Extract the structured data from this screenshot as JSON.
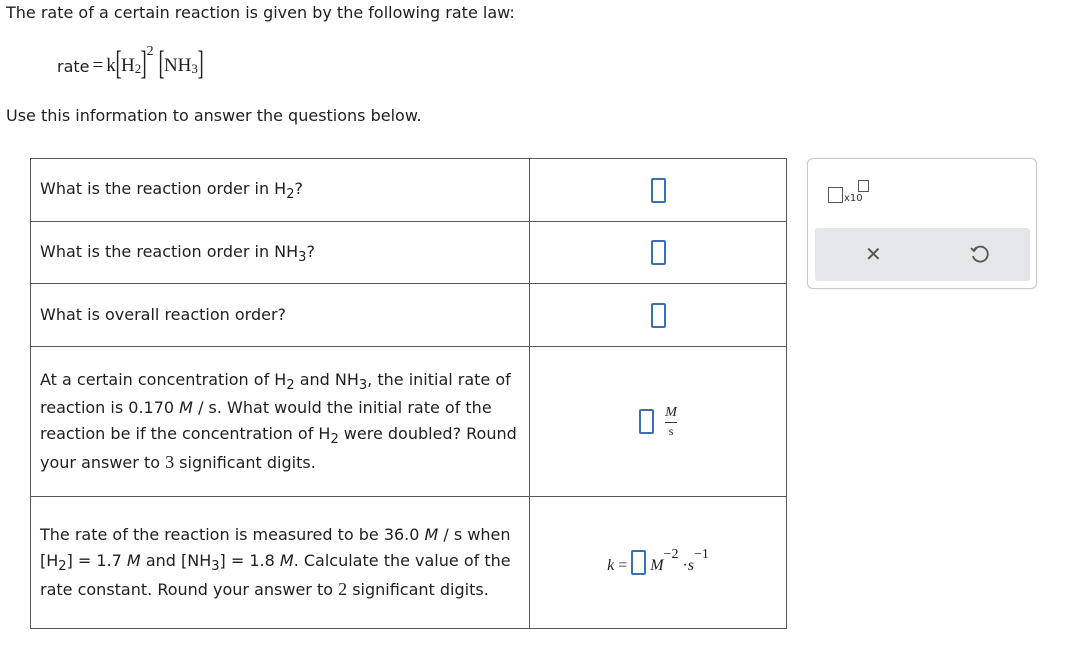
{
  "intro": "The rate of a certain reaction is given by the following rate law:",
  "rate_law": {
    "word": "rate",
    "eq": "=",
    "k": "k",
    "species1": "H",
    "species1_sub": "2",
    "species1_exp": "2",
    "species2": "NH",
    "species2_sub": "3"
  },
  "use_text": "Use this information to answer the questions below.",
  "rows": [
    {
      "q_pre": "What is the reaction order in H",
      "q_sub": "2",
      "q_post": "?"
    },
    {
      "q_pre": "What is the reaction order in NH",
      "q_sub": "3",
      "q_post": "?"
    },
    {
      "q": "What is overall reaction order?"
    },
    {
      "q_a": "At a certain concentration of H",
      "q_a_sub": "2",
      "q_b": " and NH",
      "q_b_sub": "3",
      "q_c": ", the initial rate of reaction is 0.170 ",
      "q_c_unit": "M",
      "q_d": " / s. What would the initial rate of the reaction be if the concentration of H",
      "q_d_sub": "2",
      "q_e": " were doubled? Round your answer to ",
      "q_e_num": "3",
      "q_f": " significant digits.",
      "unit_num": "M",
      "unit_den": "s"
    },
    {
      "q_a": "The rate of the reaction is measured to be 36.0 ",
      "q_a_unit": "M",
      "q_b": " / s when [H",
      "q_b_sub": "2",
      "q_c": "] = 1.7 ",
      "q_c_unit": "M",
      "q_d": " and [NH",
      "q_d_sub": "3",
      "q_e": "] = 1.8 ",
      "q_e_unit": "M",
      "q_f": ". Calculate the value of the rate constant. Round your answer to ",
      "q_f_num": "2",
      "q_g": " significant digits.",
      "k_label": "k",
      "k_eq": "=",
      "unit_M": "M",
      "exp_M": "−2",
      "dot": "·",
      "unit_s": "s",
      "exp_s": "−1"
    }
  ],
  "tools": {
    "x10_label": "x10",
    "close_icon": "close-icon",
    "undo_icon": "undo-icon"
  },
  "colors": {
    "input_border": "#3d6fb5",
    "panel_bar": "#e3e6ea"
  }
}
